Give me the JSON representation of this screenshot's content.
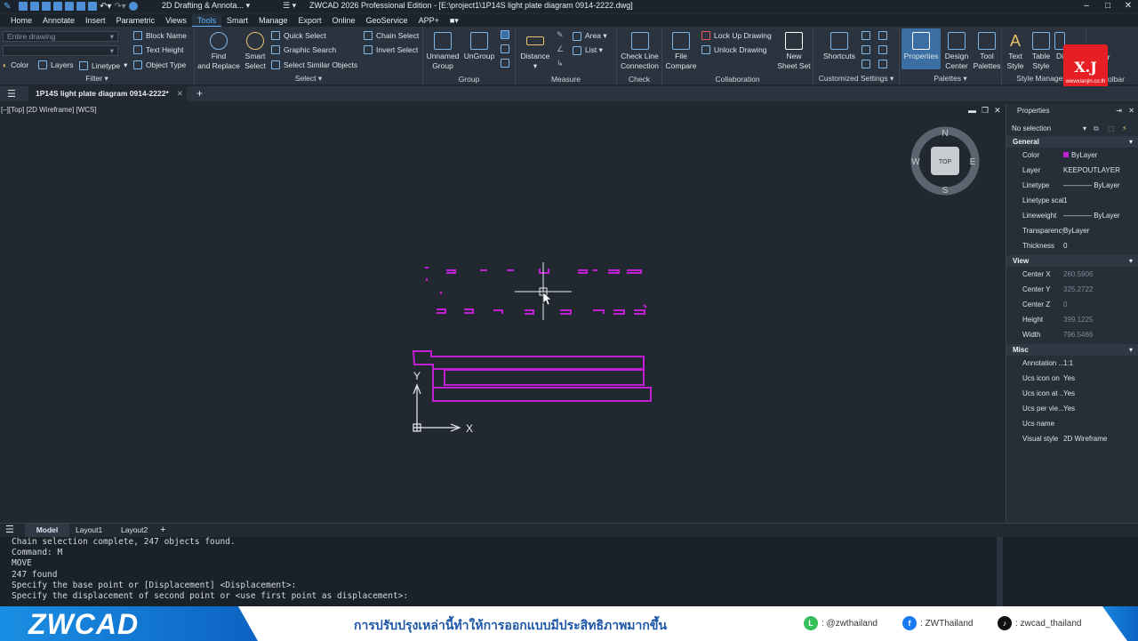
{
  "titlebar": {
    "workspace": "2D Drafting & Annota...",
    "title": "ZWCAD 2026 Professional Edition - [E:\\project1\\1P14S light plate diagram 0914-2222.dwg]",
    "minimize": "–",
    "maximize": "□",
    "close": "✕"
  },
  "menu": [
    "Home",
    "Annotate",
    "Insert",
    "Parametric",
    "Views",
    "Tools",
    "Smart",
    "Manage",
    "Export",
    "Online",
    "GeoService",
    "APP+"
  ],
  "menu_active": "Tools",
  "ribbon": {
    "filter": {
      "scope_value": "Entire drawing",
      "color_label": "Color",
      "layers_label": "Layers",
      "linetype_label": "Linetype",
      "block_name": "Block Name",
      "text_height": "Text Height",
      "object_type": "Object Type",
      "title": "Filter ▾"
    },
    "select": {
      "find_replace": "Find\nand Replace",
      "find_l1": "Find",
      "find_l2": "and Replace",
      "smart_l1": "Smart",
      "smart_l2": "Select",
      "quick_select": "Quick Select",
      "graphic_search": "Graphic Search",
      "select_similar": "Select Similar Objects",
      "chain_select": "Chain Select",
      "invert_select": "Invert Select",
      "title": "Select ▾"
    },
    "group": {
      "unnamed_l1": "Unnamed",
      "unnamed_l2": "Group",
      "ungroup": "UnGroup",
      "title": "Group"
    },
    "measure": {
      "distance": "Distance",
      "area": "Area ▾",
      "list": "List ▾",
      "title": "Measure"
    },
    "check": {
      "l1": "Check Line",
      "l2": "Connection",
      "title": "Check"
    },
    "collaboration": {
      "file_l1": "File",
      "file_l2": "Compare",
      "lock": "Lock Up Drawing",
      "unlock": "Unlock Drawing",
      "new_l1": "New",
      "new_l2": "Sheet Set",
      "title": "Collaboration"
    },
    "custom": {
      "shortcuts": "Shortcuts",
      "title": "Customized Settings ▾"
    },
    "palettes": {
      "properties": "Properties",
      "design_l1": "Design",
      "design_l2": "Center",
      "tool_l1": "Tool",
      "tool_l2": "Palettes",
      "title": "Palettes ▾"
    },
    "style": {
      "text_l1": "Text",
      "text_l2": "Style",
      "table_l1": "Table",
      "table_l2": "Style",
      "di": "Di",
      "title": "Style Manager ▾"
    },
    "toolbar": {
      "label": "olbar",
      "title": "Toolbar"
    }
  },
  "badge": {
    "text": "X.J",
    "sub": "wwwxianjin.co.th"
  },
  "doc_tab": {
    "label": "1P14S light plate diagram 0914-2222*",
    "close": "✕",
    "add": "+"
  },
  "viewport": {
    "label": "[–][Top] [2D Wireframe] [WCS]",
    "viewcube": {
      "n": "N",
      "s": "S",
      "e": "E",
      "w": "W",
      "top": "TOP"
    },
    "ucs": {
      "x": "X",
      "y": "Y"
    },
    "close": "✕"
  },
  "properties": {
    "title": "Properties",
    "selection": "No selection",
    "sections": {
      "general": "General",
      "view": "View",
      "misc": "Misc"
    },
    "general": [
      {
        "k": "Color",
        "v": "ByLayer"
      },
      {
        "k": "Layer",
        "v": "KEEPOUTLAYER"
      },
      {
        "k": "Linetype",
        "v": "———— ByLayer"
      },
      {
        "k": "Linetype scale",
        "v": "1"
      },
      {
        "k": "Lineweight",
        "v": "———— ByLayer"
      },
      {
        "k": "Transparency",
        "v": "ByLayer"
      },
      {
        "k": "Thickness",
        "v": "0"
      }
    ],
    "view": [
      {
        "k": "Center X",
        "v": "260.5906"
      },
      {
        "k": "Center Y",
        "v": "325.2722"
      },
      {
        "k": "Center Z",
        "v": "0"
      },
      {
        "k": "Height",
        "v": "399.1225"
      },
      {
        "k": "Width",
        "v": "796.5466"
      }
    ],
    "misc": [
      {
        "k": "Annotation ...",
        "v": "1:1"
      },
      {
        "k": "Ucs icon on",
        "v": "Yes"
      },
      {
        "k": "Ucs icon at ...",
        "v": "Yes"
      },
      {
        "k": "Ucs per vie...",
        "v": "Yes"
      },
      {
        "k": "Ucs name",
        "v": ""
      },
      {
        "k": "Visual style",
        "v": "2D Wireframe"
      }
    ]
  },
  "layout_tabs": [
    "Model",
    "Layout1",
    "Layout2"
  ],
  "layout_add": "+",
  "command_lines": [
    "Chain selection complete, 247 objects found.",
    "Command: M",
    "MOVE",
    "247 found",
    "Specify the base point or [Displacement] <Displacement>:",
    "Specify the displacement of second point or <use first point as displacement>:"
  ],
  "banner": {
    "logo": "ZWCAD",
    "message": "การปรับปรุงเหล่านี้ทำให้การออกแบบมีประสิทธิภาพมากขึ้น",
    "line": ": @zwthailand",
    "facebook": ": ZWThailand",
    "tiktok": ": zwcad_thailand"
  },
  "colors": {
    "accent": "#5fb2ff",
    "drawing": "#c21fd4",
    "background": "#212830"
  }
}
